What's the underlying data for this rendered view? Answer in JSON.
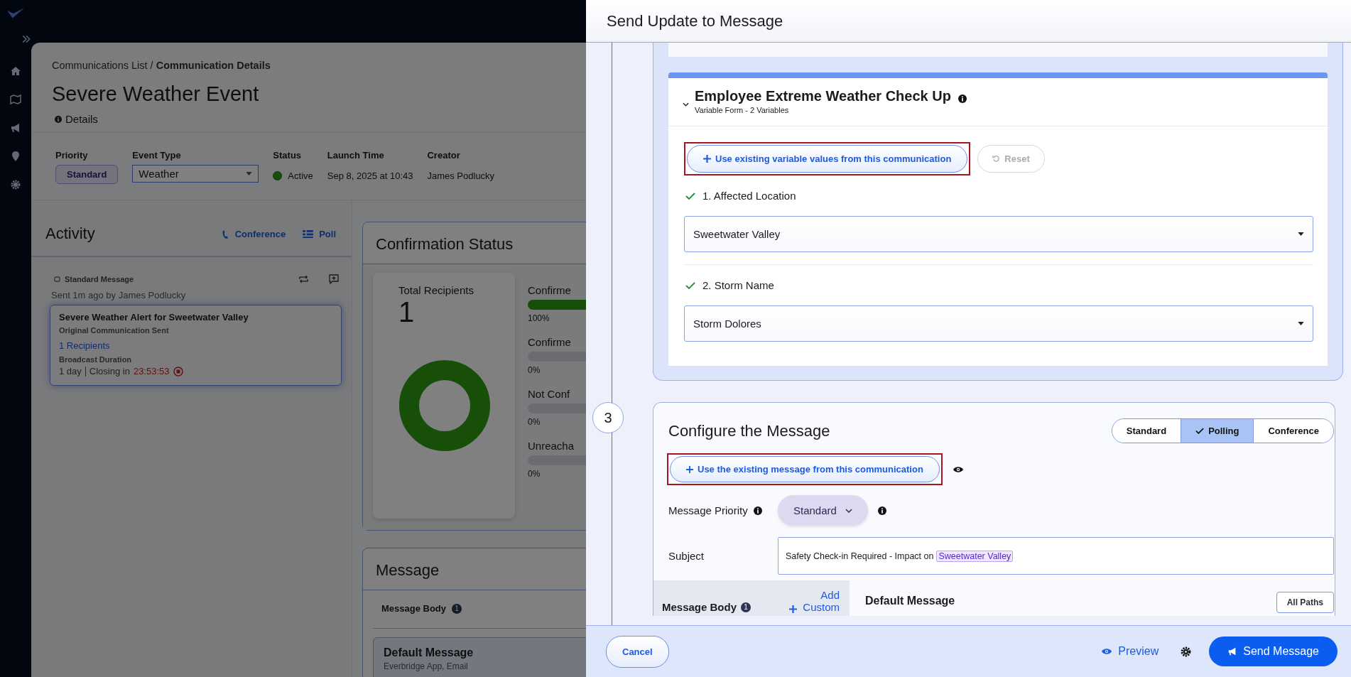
{
  "page": {
    "breadcrumb": "Communications List / **Communication Details**",
    "title": "Severe Weather Event",
    "details_link": "Details",
    "fields": {
      "priority": {
        "label": "Priority",
        "value": "Standard"
      },
      "event_type": {
        "label": "Event Type",
        "value": "Weather"
      },
      "status": {
        "label": "Status",
        "value": "Active"
      },
      "launch_time": {
        "label": "Launch Time",
        "value": "Sep 8, 2025 at 10:43"
      },
      "creator": {
        "label": "Creator",
        "value": "James Podlucky"
      }
    },
    "activity": {
      "title": "Activity",
      "conference": "Conference",
      "poll": "Poll",
      "entry": {
        "type": "Standard Message",
        "meta": "Sent 1m ago by James Podlucky",
        "title": "Severe Weather Alert for Sweetwater Valley",
        "subtitle": "Original Communication Sent",
        "recipients": "1 Recipients",
        "duration_label": "Broadcast Duration",
        "duration": "1 day",
        "closing_label": "Closing in",
        "countdown": "23:53:53"
      }
    },
    "confirmation": {
      "title": "Confirmation Status",
      "total_label": "Total Recipients",
      "total": "1",
      "stats": [
        {
          "label": "Confirme",
          "level": 1,
          "percent": "100%"
        },
        {
          "label": "Confirme",
          "level": 0,
          "percent": "0%"
        },
        {
          "label": "Not Conf",
          "level": 0,
          "percent": "0%"
        },
        {
          "label": "Unreacha",
          "level": 0,
          "percent": "0%"
        }
      ]
    },
    "message": {
      "title": "Message",
      "body_label": "Message Body",
      "body_count": "1",
      "default_title": "Default Message",
      "default_paths": "Everbridge App, Email"
    }
  },
  "drawer": {
    "title": "Send Update to Message",
    "form": {
      "title": "Employee Extreme Weather Check Up",
      "subtitle": "Variable Form - 2 Variables",
      "expanded": true,
      "use_existing": "Use existing variable values from this communication",
      "use_existing_highlighted": true,
      "reset": "Reset",
      "reset_disabled": true,
      "variables": [
        {
          "label": "1. Affected Location",
          "value": "Sweetwater Valley",
          "valid": true
        },
        {
          "label": "2. Storm Name",
          "value": "Storm Dolores",
          "valid": true
        }
      ]
    },
    "step": {
      "number": "3",
      "title": "Configure the Message",
      "modes": [
        {
          "label": "Standard",
          "selected": false
        },
        {
          "label": "Polling",
          "selected": true
        },
        {
          "label": "Conference",
          "selected": false
        }
      ],
      "use_existing": "Use the existing message from this communication",
      "use_existing_highlighted": true,
      "priority_label": "Message Priority",
      "priority": "Standard",
      "subject_label": "Subject",
      "subject_text": "Safety Check-in Required - Impact on",
      "subject_variable": "Sweetwater Valley",
      "body_label": "Message Body",
      "body_count": "1",
      "add_custom": "Add Custom",
      "default_title": "Default Message",
      "all_paths": "All Paths"
    },
    "footer": {
      "cancel": "Cancel",
      "preview": "Preview",
      "send": "Send Message"
    }
  }
}
